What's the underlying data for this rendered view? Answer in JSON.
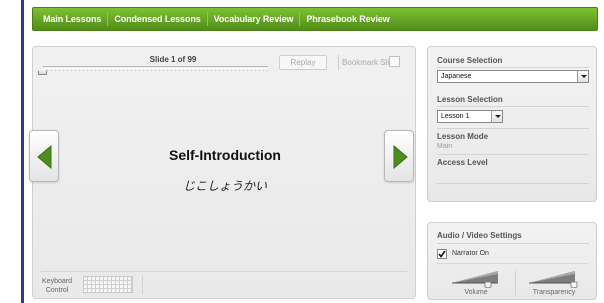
{
  "nav": {
    "items": [
      {
        "label": "Main Lessons"
      },
      {
        "label": "Condensed Lessons"
      },
      {
        "label": "Vocabulary Review"
      },
      {
        "label": "Phrasebook Review"
      }
    ]
  },
  "player": {
    "slide_label": "Slide 1 of 99",
    "replay_label": "Replay",
    "bookmark_label": "Bookmark Slide",
    "bookmark_checked": false,
    "progress": 0.0,
    "slide_title": "Self-Introduction",
    "slide_subtitle": "じこしょうかい",
    "keyboard_label": "Keyboard Control"
  },
  "settings": {
    "course_heading": "Course Selection",
    "course_value": "Japanese",
    "lesson_heading": "Lesson Selection",
    "lesson_value": "Lesson 1",
    "mode_heading": "Lesson Mode",
    "mode_value": "Main",
    "access_heading": "Access Level"
  },
  "av": {
    "heading": "Audio / Video Settings",
    "narrator_label": "Narrator On",
    "narrator_checked": true,
    "volume_label": "Volume",
    "volume_level": 0.75,
    "transparency_label": "Transparency",
    "transparency_level": 0.95
  },
  "colors": {
    "nav_green": "#5d9e1f",
    "arrow_green": "#4f8e1e",
    "left_rule": "#2a39a8"
  },
  "icons": {
    "prev": "chevron-left-icon",
    "next": "chevron-right-icon",
    "keyboard": "keyboard-icon",
    "check": "check-icon"
  }
}
